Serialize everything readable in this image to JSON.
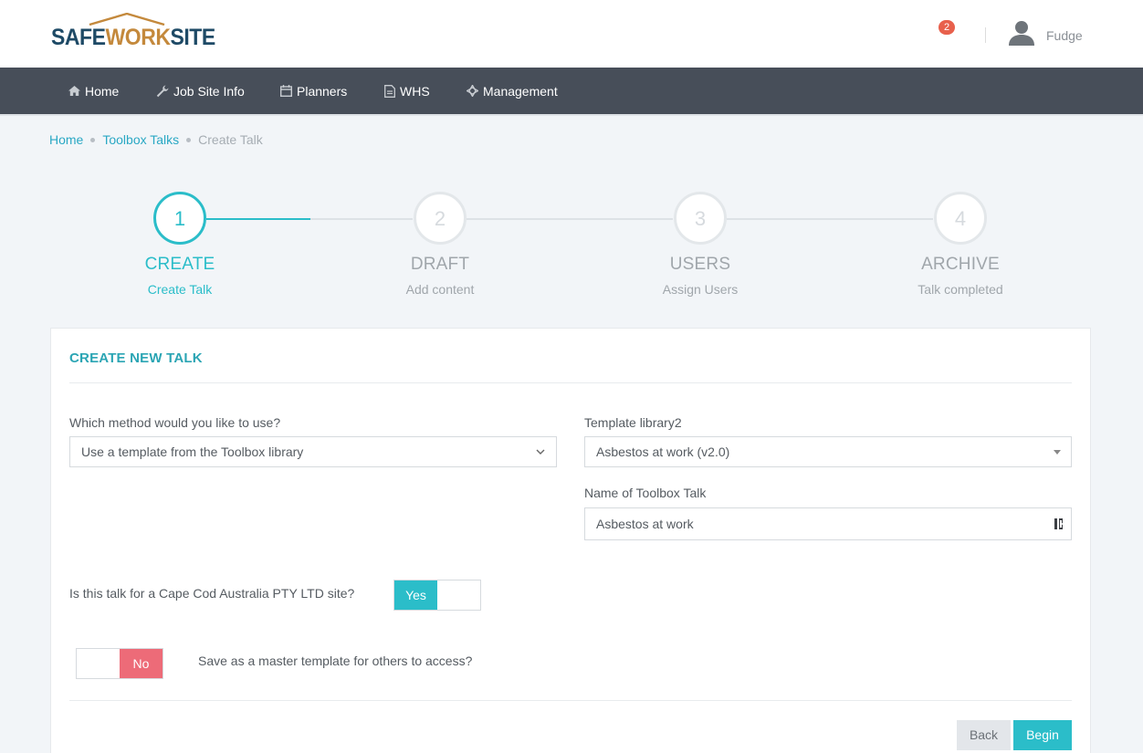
{
  "header": {
    "logo": {
      "part1": "SAFE",
      "part2": "WORK",
      "part3": "SITE"
    },
    "notification_count": "2",
    "user_name": "Fudge"
  },
  "nav": {
    "items": [
      {
        "label": "Home",
        "icon": "home-icon"
      },
      {
        "label": "Job Site Info",
        "icon": "wrench-icon"
      },
      {
        "label": "Planners",
        "icon": "calendar-icon"
      },
      {
        "label": "WHS",
        "icon": "document-icon"
      },
      {
        "label": "Management",
        "icon": "crosshair-icon"
      }
    ]
  },
  "breadcrumb": {
    "items": [
      "Home",
      "Toolbox Talks"
    ],
    "current": "Create Talk"
  },
  "stepper": {
    "active_step": 1,
    "steps": [
      {
        "number": "1",
        "title": "CREATE",
        "subtitle": "Create Talk"
      },
      {
        "number": "2",
        "title": "DRAFT",
        "subtitle": "Add content"
      },
      {
        "number": "3",
        "title": "USERS",
        "subtitle": "Assign Users"
      },
      {
        "number": "4",
        "title": "ARCHIVE",
        "subtitle": "Talk completed"
      }
    ]
  },
  "form": {
    "title": "CREATE NEW TALK",
    "method": {
      "label": "Which method would you like to use?",
      "value": "Use a template from the Toolbox library"
    },
    "template": {
      "label": "Template library2",
      "value": "Asbestos at work (v2.0)"
    },
    "talk_name": {
      "label": "Name of Toolbox Talk",
      "value": "Asbestos at work"
    },
    "site_question": {
      "label": "Is this talk for a Cape Cod Australia PTY LTD site?",
      "toggle": "Yes"
    },
    "master_question": {
      "label": "Save as a master template for others to access?",
      "toggle": "No"
    },
    "buttons": {
      "back": "Back",
      "begin": "Begin"
    }
  },
  "colors": {
    "accent": "#2bbdc9",
    "nav_bg": "#474e59",
    "no_toggle": "#ed6b78",
    "notification": "#e8604c",
    "logo_dark": "#1e4a66",
    "logo_orange": "#c4893c"
  }
}
